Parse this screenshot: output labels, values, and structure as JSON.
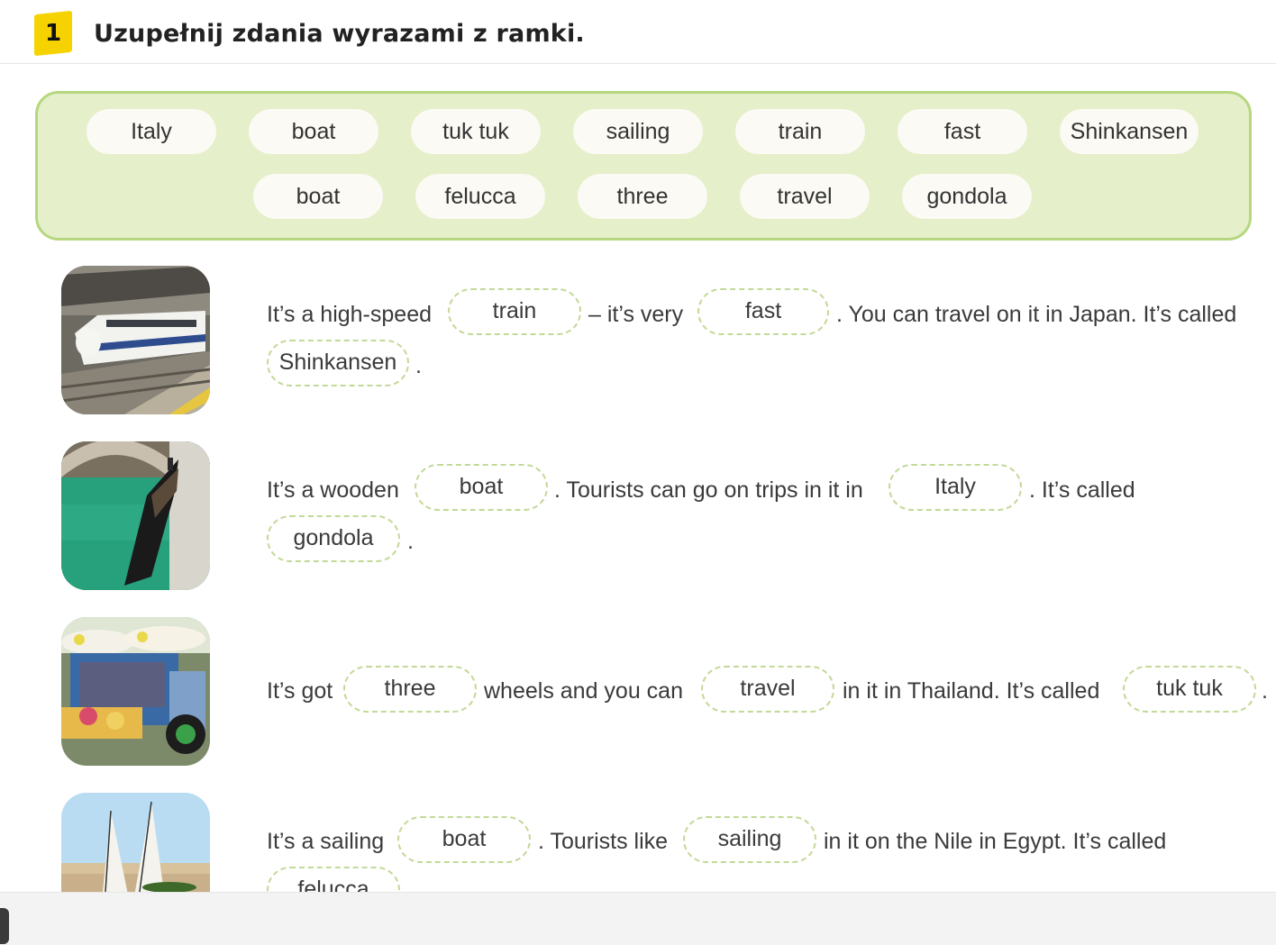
{
  "exercise": {
    "number": "1",
    "title": "Uzupełnij zdania wyrazami z ramki."
  },
  "word_box": {
    "row1": [
      "Italy",
      "boat",
      "tuk tuk",
      "sailing",
      "train",
      "fast",
      "Shinkansen"
    ],
    "row2": [
      "boat",
      "felucca",
      "three",
      "travel",
      "gondola"
    ]
  },
  "sentences": [
    {
      "image": "shinkansen-train-photo",
      "t1": "It’s a high-speed",
      "b1": "train",
      "t2": "– it’s very",
      "b2": "fast",
      "t3": ". You can travel on it in Japan. It’s called",
      "b3": "Shinkansen",
      "t4": "."
    },
    {
      "image": "gondola-photo",
      "t1": "It’s a wooden",
      "b1": "boat",
      "t2": ". Tourists can go on trips in it in",
      "b2": "Italy",
      "t3": ". It’s called",
      "b3": "gondola",
      "t4": "."
    },
    {
      "image": "tuk-tuk-photo",
      "t1": "It’s got",
      "b1": "three",
      "t2": "wheels and you can",
      "b2": "travel",
      "t3": "in it in Thailand. It’s called",
      "b3": "tuk tuk",
      "t4": "."
    },
    {
      "image": "felucca-photo",
      "t1": "It’s a sailing",
      "b1": "boat",
      "t2": ". Tourists like",
      "b2": "sailing",
      "t3": "in it on the Nile in Egypt. It’s called",
      "b3": "felucca"
    }
  ]
}
